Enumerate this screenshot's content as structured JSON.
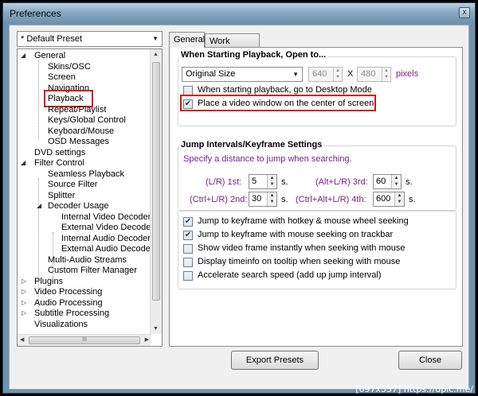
{
  "window": {
    "title": "Preferences",
    "close": "x"
  },
  "preset": {
    "value": "* Default Preset"
  },
  "tree": {
    "items": [
      {
        "label": "General",
        "exp": "◢"
      },
      {
        "label": "Skins/OSC"
      },
      {
        "label": "Screen"
      },
      {
        "label": "Navigation"
      },
      {
        "label": "Playback"
      },
      {
        "label": "Repeat/Playlist"
      },
      {
        "label": "Keys/Global Control"
      },
      {
        "label": "Keyboard/Mouse"
      },
      {
        "label": "OSD Messages"
      },
      {
        "label": "DVD settings"
      },
      {
        "label": "Filter Control",
        "exp": "◢"
      },
      {
        "label": "Seamless Playback"
      },
      {
        "label": "Source Filter"
      },
      {
        "label": "Splitter"
      },
      {
        "label": "Decoder Usage",
        "exp": "◢"
      },
      {
        "label": "Internal Video Decoder"
      },
      {
        "label": "External Video Decoder"
      },
      {
        "label": "Internal Audio Decoder"
      },
      {
        "label": "External Audio Decoder"
      },
      {
        "label": "Multi-Audio Streams"
      },
      {
        "label": "Custom Filter Manager"
      },
      {
        "label": "Plugins",
        "exp": "▷"
      },
      {
        "label": "Video Processing",
        "exp": "▷"
      },
      {
        "label": "Audio Processing",
        "exp": "▷"
      },
      {
        "label": "Subtitle Processing",
        "exp": "▷"
      },
      {
        "label": "Visualizations"
      }
    ],
    "hscroll_grip": "III"
  },
  "tabs": [
    {
      "label": "General"
    },
    {
      "label": "Work Priority"
    }
  ],
  "open_group": {
    "title": "When Starting Playback, Open to...",
    "size_combo": "Original Size",
    "width": "640",
    "x": "X",
    "height": "480",
    "unit": "pixels",
    "chk_desktop": "When starting playback, go to Desktop Mode",
    "chk_center": "Place a video window on the center of screen",
    "chk_center_mark": "✔"
  },
  "jump_group": {
    "title": "Jump Intervals/Keyframe Settings",
    "hint": "Specify a distance to jump when searching.",
    "lr_1st": {
      "label": "(L/R) 1st:",
      "value": "5",
      "unit": "s."
    },
    "altlr_3rd": {
      "label": "(Alt+L/R) 3rd:",
      "value": "60",
      "unit": "s."
    },
    "ctrllr_2nd": {
      "label": "(Ctrl+L/R) 2nd:",
      "value": "30",
      "unit": "s."
    },
    "ctrlaltlr_4th": {
      "label": "(Ctrl+Alt+L/R) 4th:",
      "value": "600",
      "unit": "s."
    }
  },
  "options": [
    {
      "label": "Jump to keyframe with hotkey & mouse wheel seeking",
      "checked": true,
      "mark": "✔"
    },
    {
      "label": "Jump to keyframe with mouse seeking on trackbar",
      "checked": true,
      "mark": "✔"
    },
    {
      "label": "Show video frame instantly when seeking with mouse",
      "checked": false,
      "mark": ""
    },
    {
      "label": "Display timeinfo on tooltip when seeking with mouse",
      "checked": false,
      "mark": ""
    },
    {
      "label": "Accelerate search speed (add up jump interval)",
      "checked": false,
      "mark": ""
    }
  ],
  "buttons": {
    "export": "Export Presets",
    "close": "Close"
  },
  "watermark": "[697x557] https://upic.me/",
  "colors": {
    "highlight": "#d31414",
    "hint": "#7a1f8e"
  }
}
